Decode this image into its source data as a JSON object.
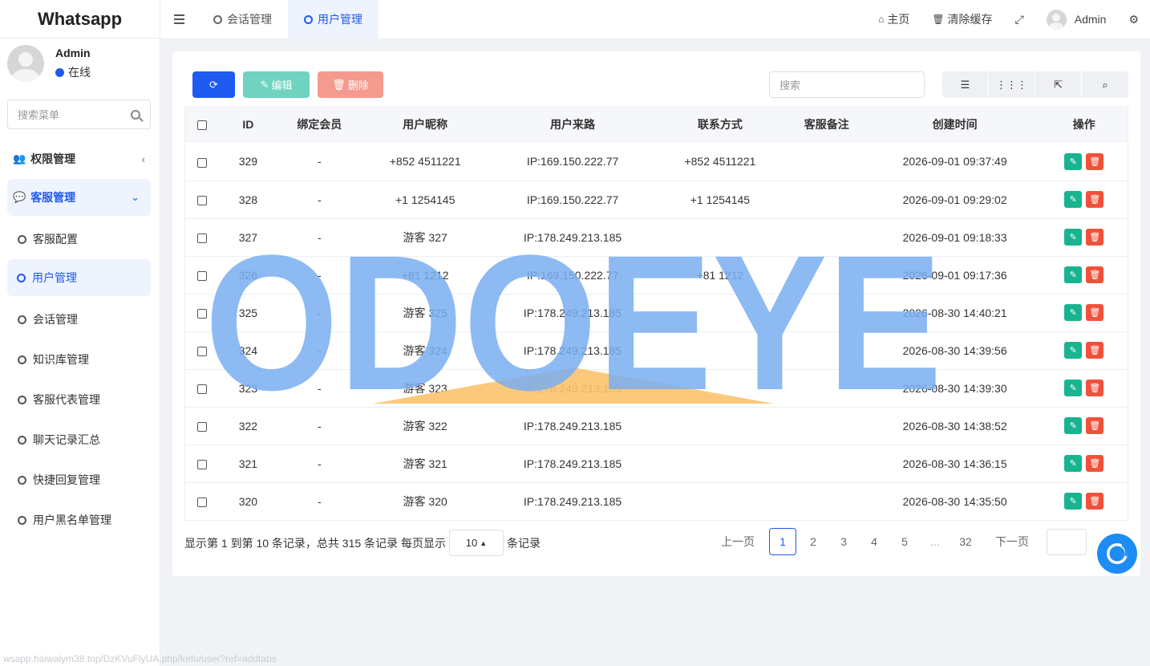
{
  "app": {
    "title": "Whatsapp"
  },
  "user": {
    "name": "Admin",
    "status": "在线"
  },
  "sidebar": {
    "search_placeholder": "搜索菜单",
    "groups": [
      {
        "label": "权限管理",
        "icon": "users-icon"
      },
      {
        "label": "客服管理",
        "icon": "comment-icon"
      }
    ],
    "items": [
      {
        "label": "客服配置"
      },
      {
        "label": "用户管理"
      },
      {
        "label": "会话管理"
      },
      {
        "label": "知识库管理"
      },
      {
        "label": "客服代表管理"
      },
      {
        "label": "聊天记录汇总"
      },
      {
        "label": "快捷回复管理"
      },
      {
        "label": "用户黑名单管理"
      }
    ]
  },
  "topbar": {
    "tabs": [
      {
        "label": "会话管理"
      },
      {
        "label": "用户管理"
      }
    ],
    "home": "主页",
    "clear_cache": "清除缓存",
    "admin": "Admin"
  },
  "toolbar": {
    "edit": "编辑",
    "delete": "删除",
    "search_placeholder": "搜索"
  },
  "table": {
    "headers": [
      "ID",
      "绑定会员",
      "用户昵称",
      "用户来路",
      "联系方式",
      "客服备注",
      "创建时间",
      "操作"
    ],
    "rows": [
      {
        "id": "329",
        "member": "-",
        "nickname": "+852 4511221",
        "source": "IP:169.150.222.77",
        "contact": "+852 4511221",
        "note": "",
        "created": "2026-09-01 09:37:49"
      },
      {
        "id": "328",
        "member": "-",
        "nickname": "+1 1254145",
        "source": "IP:169.150.222.77",
        "contact": "+1 1254145",
        "note": "",
        "created": "2026-09-01 09:29:02"
      },
      {
        "id": "327",
        "member": "-",
        "nickname": "游客 327",
        "source": "IP:178.249.213.185",
        "contact": "",
        "note": "",
        "created": "2026-09-01 09:18:33"
      },
      {
        "id": "326",
        "member": "-",
        "nickname": "+81 1212",
        "source": "IP:169.150.222.77",
        "contact": "+81 1212",
        "note": "",
        "created": "2026-09-01 09:17:36"
      },
      {
        "id": "325",
        "member": "-",
        "nickname": "游客 325",
        "source": "IP:178.249.213.185",
        "contact": "",
        "note": "",
        "created": "2026-08-30 14:40:21"
      },
      {
        "id": "324",
        "member": "-",
        "nickname": "游客 324",
        "source": "IP:178.249.213.185",
        "contact": "",
        "note": "",
        "created": "2026-08-30 14:39:56"
      },
      {
        "id": "323",
        "member": "-",
        "nickname": "游客 323",
        "source": "IP:178.249.213.185",
        "contact": "",
        "note": "",
        "created": "2026-08-30 14:39:30"
      },
      {
        "id": "322",
        "member": "-",
        "nickname": "游客 322",
        "source": "IP:178.249.213.185",
        "contact": "",
        "note": "",
        "created": "2026-08-30 14:38:52"
      },
      {
        "id": "321",
        "member": "-",
        "nickname": "游客 321",
        "source": "IP:178.249.213.185",
        "contact": "",
        "note": "",
        "created": "2026-08-30 14:36:15"
      },
      {
        "id": "320",
        "member": "-",
        "nickname": "游客 320",
        "source": "IP:178.249.213.185",
        "contact": "",
        "note": "",
        "created": "2026-08-30 14:35:50"
      }
    ]
  },
  "pagination": {
    "summary": "显示第 1 到第 10 条记录，总共 315 条记录 每页显示",
    "page_size": "10",
    "suffix": "条记录",
    "prev": "上一页",
    "pages": [
      "1",
      "2",
      "3",
      "4",
      "5",
      "...",
      "32"
    ],
    "next": "下一页"
  },
  "watermark": {
    "text": "ODOEYE"
  },
  "status_url": "wsapp.haiwaiym38.top/DzKVuFlyUA.php/kefu/user?ref=addtabs",
  "colors": {
    "primary": "#1e5af0",
    "success": "#18b48f",
    "danger": "#f0513a",
    "watermark_blue": "#7aaff0",
    "watermark_orange": "#fcc36e"
  }
}
